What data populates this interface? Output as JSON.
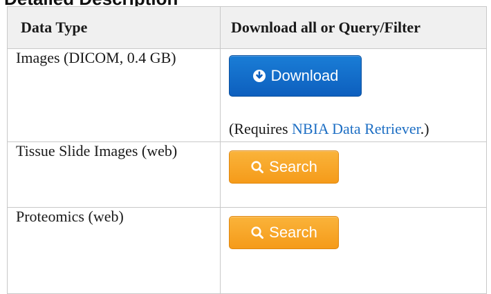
{
  "section": {
    "heading_fragment": "Detailed Description"
  },
  "table": {
    "headers": [
      "Data Type",
      "Download all or Query/Filter"
    ],
    "rows": [
      {
        "type": "Images (DICOM, 0.4 GB)",
        "button": {
          "label": "Download",
          "icon": "download-circle-icon"
        },
        "note_prefix": "(Requires ",
        "note_link": "NBIA Data Retriever",
        "note_suffix": ".)"
      },
      {
        "type": "Tissue Slide Images (web)",
        "button": {
          "label": "Search",
          "icon": "search-icon"
        }
      },
      {
        "type": "Proteomics (web)",
        "button": {
          "label": "Search",
          "icon": "search-icon"
        }
      }
    ]
  },
  "colors": {
    "download_button": "#0d6efd",
    "search_button": "#f7a21e",
    "link": "#1e6fc4",
    "header_bg": "#f0f0f0",
    "border": "#c8c8c8"
  }
}
